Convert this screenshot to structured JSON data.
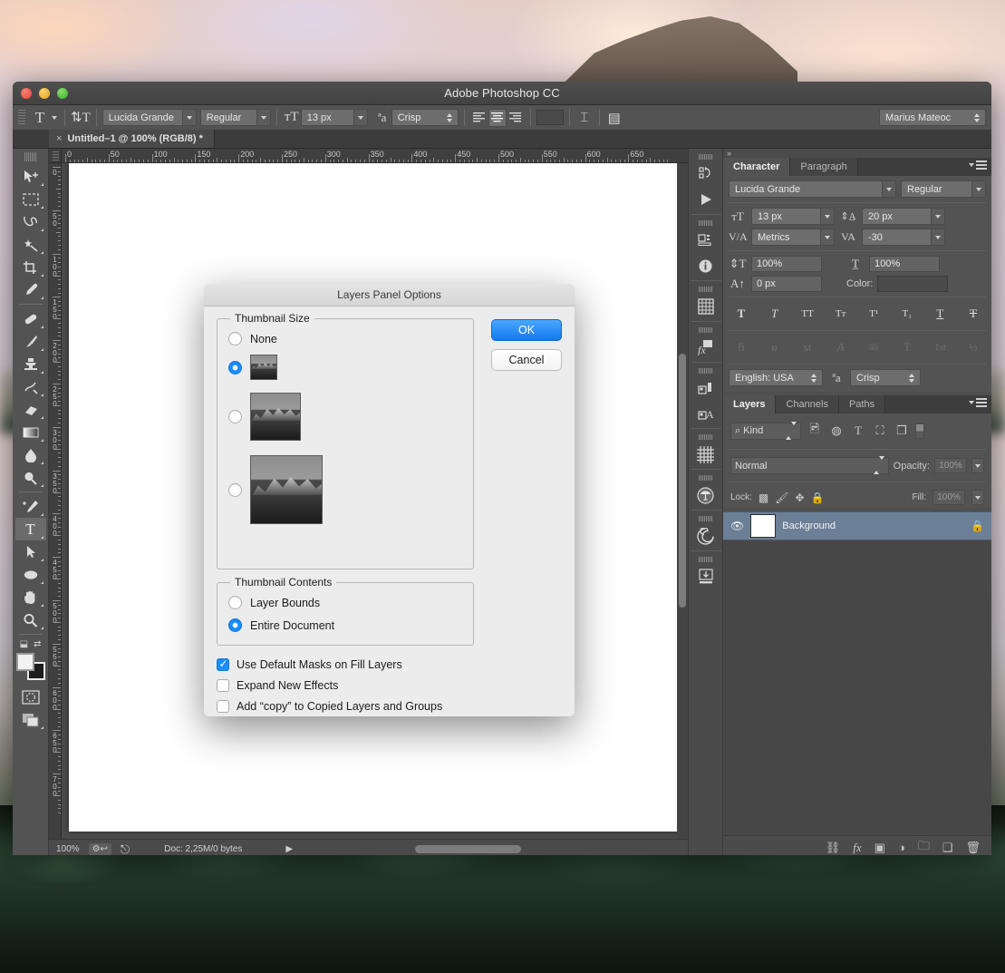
{
  "window": {
    "title": "Adobe Photoshop CC",
    "traffic_lights": [
      "close",
      "minimize",
      "maximize"
    ]
  },
  "options_bar": {
    "tool_icon": "type-tool-icon",
    "orientation_icon": "text-orientation-icon",
    "font_family": "Lucida Grande",
    "font_style": "Regular",
    "size_icon": "font-size-icon",
    "font_size": "13 px",
    "antialias_icon": "anti-aliasing-icon",
    "antialias": "Crisp",
    "align": [
      "left",
      "center",
      "right"
    ],
    "align_active": "center",
    "color_label": "text-color-swatch",
    "warp_icon": "warp-text-icon",
    "panel_icon": "toggle-character-panel-icon",
    "workspace": "Marius Mateoc"
  },
  "document_tab": {
    "close": "×",
    "label": "Untitled–1 @ 100% (RGB/8) *"
  },
  "toolbox": {
    "tools": [
      {
        "name": "move-tool",
        "glyph": "↖"
      },
      {
        "name": "rectangular-marquee-tool",
        "glyph": "⬚"
      },
      {
        "name": "lasso-tool",
        "glyph": "➿"
      },
      {
        "name": "magic-wand-tool",
        "glyph": "✦"
      },
      {
        "name": "crop-tool",
        "glyph": "⌗"
      },
      {
        "name": "eyedropper-tool",
        "glyph": "✒"
      },
      {
        "name": "spot-healing-brush-tool",
        "glyph": "✐"
      },
      {
        "name": "brush-tool",
        "glyph": "✑"
      },
      {
        "name": "clone-stamp-tool",
        "glyph": "⚑"
      },
      {
        "name": "history-brush-tool",
        "glyph": "❦"
      },
      {
        "name": "eraser-tool",
        "glyph": "▱"
      },
      {
        "name": "gradient-tool",
        "glyph": "▤"
      },
      {
        "name": "blur-tool",
        "glyph": "●"
      },
      {
        "name": "dodge-tool",
        "glyph": "⚲"
      },
      {
        "name": "pen-tool",
        "glyph": "✒"
      },
      {
        "name": "type-tool",
        "glyph": "T",
        "active": true
      },
      {
        "name": "path-selection-tool",
        "glyph": "➤"
      },
      {
        "name": "ellipse-tool",
        "glyph": "⬭"
      },
      {
        "name": "hand-tool",
        "glyph": "✋"
      },
      {
        "name": "zoom-tool",
        "glyph": "⚲"
      }
    ],
    "swap_colors_icon": "swap-colors-icon",
    "default_colors_icon": "default-colors-icon",
    "foreground_color": "#f2f2f2",
    "background_color": "#1c1c1c",
    "quick_mask_icon": "quick-mask-mode-icon",
    "screen_mode_icon": "screen-mode-icon"
  },
  "rulers": {
    "h_labels": [
      "0",
      "50",
      "100",
      "150",
      "200",
      "250",
      "300",
      "350",
      "400",
      "450",
      "500",
      "550",
      "600",
      "650"
    ],
    "v_labels": [
      "0",
      "50",
      "100",
      "150",
      "200",
      "250",
      "300",
      "350",
      "400",
      "450",
      "500",
      "550",
      "600",
      "650",
      "700"
    ],
    "unit": "px"
  },
  "statusbar": {
    "zoom": "100%",
    "icon_left": "document-settings-icon",
    "icon_share": "share-icon",
    "doc_info": "Doc: 2,25M/0 bytes",
    "expand_arrow": "▶"
  },
  "icon_dock": {
    "items": [
      {
        "name": "history-panel-icon",
        "glyph": "↶"
      },
      {
        "name": "actions-panel-icon",
        "glyph": "▶"
      },
      {
        "name": "3d-panel-icon",
        "glyph": "⬛"
      },
      {
        "name": "info-panel-icon",
        "glyph": "ℹ"
      },
      {
        "name": "histogram-panel-icon",
        "glyph": "▦"
      },
      {
        "name": "styles-panel-icon",
        "glyph": "fx"
      },
      {
        "name": "layer-comps-panel-icon",
        "glyph": "◳"
      },
      {
        "name": "glyphs-panel-icon",
        "glyph": "A"
      },
      {
        "name": "brush-presets-panel-icon",
        "glyph": "⌗"
      },
      {
        "name": "adjustments-panel-icon",
        "glyph": "☸"
      },
      {
        "name": "properties-panel-icon",
        "glyph": "◎"
      },
      {
        "name": "export-panel-icon",
        "glyph": "↧"
      }
    ]
  },
  "character_panel": {
    "tabs": [
      {
        "label": "Character",
        "active": true
      },
      {
        "label": "Paragraph",
        "active": false
      }
    ],
    "menu_icon": "panel-menu-icon",
    "font_family": "Lucida Grande",
    "font_style": "Regular",
    "font_size_icon": "font-size-icon",
    "font_size": "13 px",
    "leading_icon": "leading-icon",
    "leading": "20 px",
    "kerning_icon": "kerning-icon",
    "kerning": "Metrics",
    "tracking_icon": "tracking-icon",
    "tracking": "-30",
    "vertical_scale_icon": "vertical-scale-icon",
    "vertical_scale": "100%",
    "horizontal_scale_icon": "horizontal-scale-icon",
    "horizontal_scale": "100%",
    "baseline_icon": "baseline-shift-icon",
    "baseline_shift": "0 px",
    "color_label": "Color:",
    "color_value": "#4a4a4a",
    "style_buttons": [
      "T",
      "T",
      "TT",
      "Tᴛ",
      "T¹",
      "T₁",
      "T",
      "T"
    ],
    "style_names": [
      "faux-bold",
      "faux-italic",
      "all-caps",
      "small-caps",
      "superscript",
      "subscript",
      "underline",
      "strikethrough"
    ],
    "opentype_buttons": [
      "fi",
      "ѳ",
      "st",
      "ᴬ",
      "aā",
      "T",
      "1st",
      "½"
    ],
    "opentype_names": [
      "standard-ligatures",
      "discretionary-ligatures",
      "contextual-alternates",
      "swash",
      "stylistic-alternates",
      "titling-alternates",
      "ordinals",
      "fractions"
    ],
    "language": "English: USA",
    "antialias_icon": "anti-aliasing-icon",
    "antialias": "Crisp"
  },
  "layers_panel": {
    "tabs": [
      {
        "label": "Layers",
        "active": true
      },
      {
        "label": "Channels",
        "active": false
      },
      {
        "label": "Paths",
        "active": false
      }
    ],
    "menu_icon": "panel-menu-icon",
    "filter_icon": "search-icon",
    "filter_label": "Kind",
    "filter_toggles": [
      "pixel-layer-filter-icon",
      "adjustment-layer-filter-icon",
      "type-layer-filter-icon",
      "shape-layer-filter-icon",
      "smart-object-filter-icon"
    ],
    "filter_switch": "filter-enable-switch",
    "blend_mode": "Normal",
    "opacity_label": "Opacity:",
    "opacity_value": "100%",
    "lock_label": "Lock:",
    "lock_icons": [
      "lock-transparent-pixels-icon",
      "lock-image-pixels-icon",
      "lock-position-icon",
      "lock-all-icon"
    ],
    "fill_label": "Fill:",
    "fill_value": "100%",
    "rows": [
      {
        "visible": true,
        "eye_icon": "eye-icon",
        "name": "Background",
        "locked": true,
        "lock_icon": "lock-icon",
        "selected": true
      }
    ],
    "footer_icons": [
      {
        "name": "link-layers-icon",
        "glyph": "⚭"
      },
      {
        "name": "layer-style-icon",
        "glyph": "fx"
      },
      {
        "name": "layer-mask-icon",
        "glyph": "▣"
      },
      {
        "name": "adjustment-layer-icon",
        "glyph": "◑"
      },
      {
        "name": "new-group-icon",
        "glyph": "▬"
      },
      {
        "name": "new-layer-icon",
        "glyph": "◰"
      },
      {
        "name": "delete-layer-icon",
        "glyph": "Ὕ1"
      }
    ]
  },
  "dialog": {
    "title": "Layers Panel Options",
    "ok_label": "OK",
    "cancel_label": "Cancel",
    "thumbnail_size": {
      "legend": "Thumbnail Size",
      "options": [
        {
          "label": "None",
          "selected": false,
          "thumb": null
        },
        {
          "label": "",
          "selected": true,
          "thumb": "small"
        },
        {
          "label": "",
          "selected": false,
          "thumb": "medium"
        },
        {
          "label": "",
          "selected": false,
          "thumb": "large"
        }
      ]
    },
    "thumbnail_contents": {
      "legend": "Thumbnail Contents",
      "options": [
        {
          "label": "Layer Bounds",
          "selected": false
        },
        {
          "label": "Entire Document",
          "selected": true
        }
      ]
    },
    "checkboxes": [
      {
        "label": "Use Default Masks on Fill Layers",
        "checked": true
      },
      {
        "label": "Expand New Effects",
        "checked": false
      },
      {
        "label": "Add “copy” to Copied Layers and Groups",
        "checked": false
      }
    ]
  },
  "colors": {
    "accent_blue": "#1a8cff",
    "dialog_bg": "#ececec",
    "panel_bg": "#535353",
    "window_chrome": "#4f4f4f",
    "layer_selected": "#6b7f96"
  }
}
